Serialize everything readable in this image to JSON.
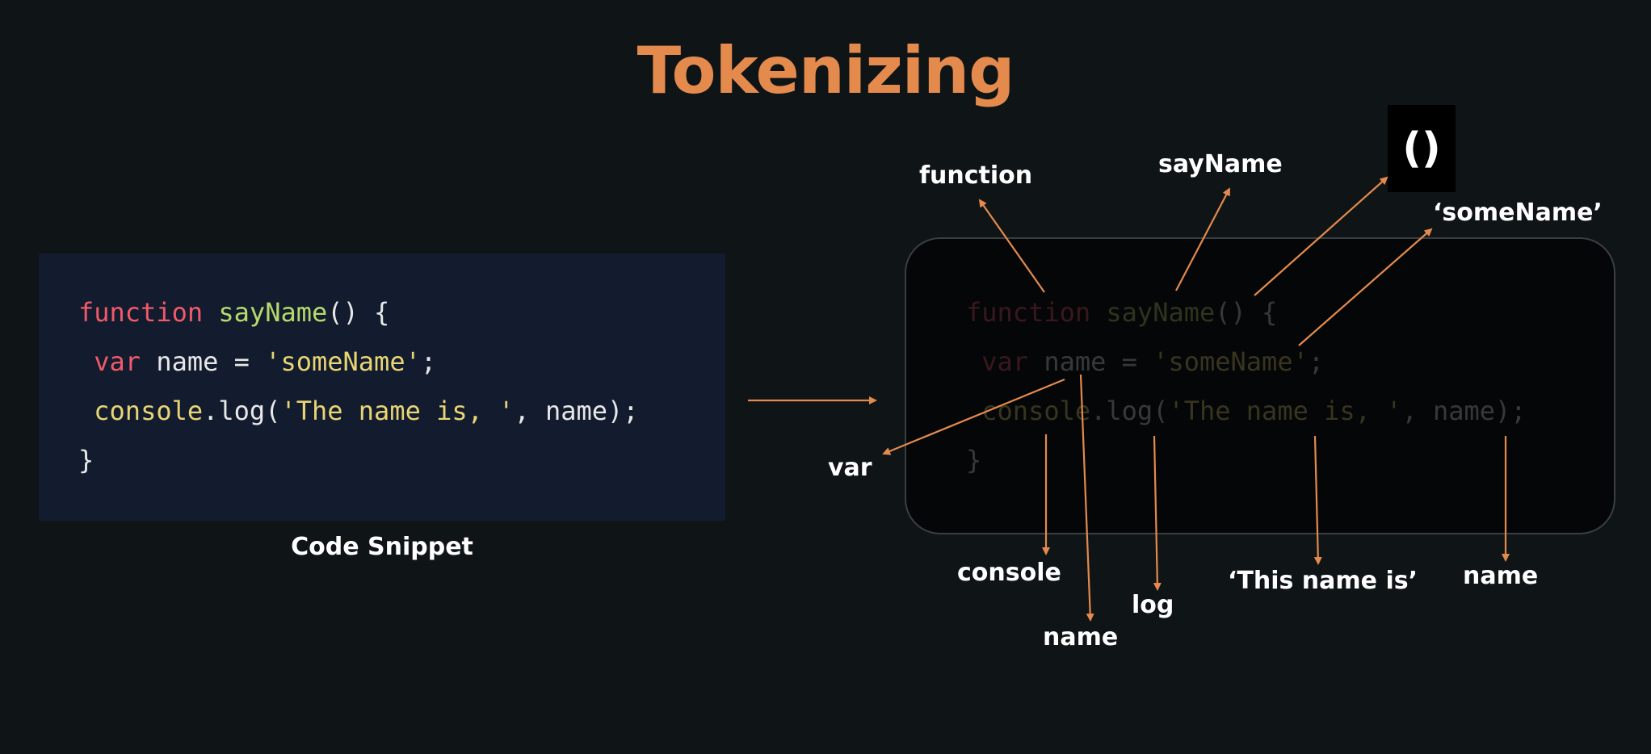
{
  "title": "Tokenizing",
  "caption": "Code Snippet",
  "code": {
    "line1": {
      "kw": "function",
      "sp": " ",
      "fn": "sayName",
      "rest": "() {"
    },
    "line2": {
      "indent": " ",
      "kw": "var",
      "mid": " name = ",
      "str": "'someName'",
      "end": ";"
    },
    "line3": {
      "indent": " ",
      "obj": "console",
      "mid": ".log(",
      "str": "'The name is, '",
      "end": ", name);"
    },
    "line4": "}"
  },
  "tokens": {
    "function": "function",
    "sayName": "sayName",
    "parens": "()",
    "someName": "‘someName’",
    "var": "var",
    "console": "console",
    "name_var": "name",
    "log": "log",
    "this_name_is": "‘This name is’",
    "name_arg": "name"
  },
  "colors": {
    "title": "#e48a4c",
    "arrow": "#e48a4c",
    "keyword": "#f05a6a",
    "function_name": "#b6d96b",
    "string": "#e8d574",
    "panel": "#131b2e"
  }
}
